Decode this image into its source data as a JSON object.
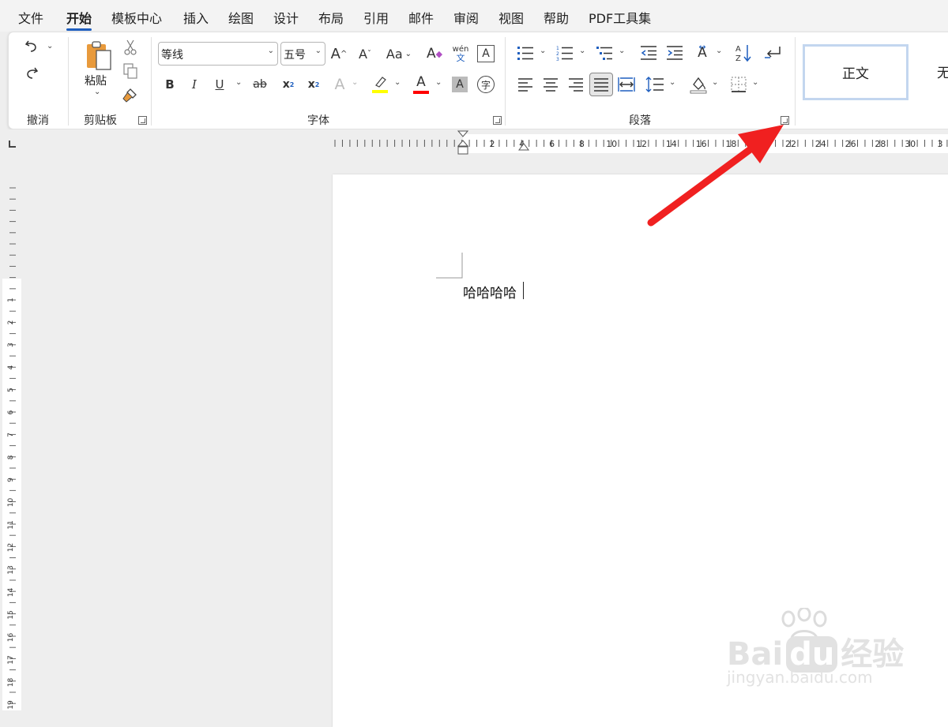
{
  "menu": {
    "tabs": [
      "文件",
      "开始",
      "模板中心",
      "插入",
      "绘图",
      "设计",
      "布局",
      "引用",
      "邮件",
      "审阅",
      "视图",
      "帮助",
      "PDF工具集"
    ],
    "active_tab": "开始"
  },
  "ribbon": {
    "undo_group_label": "撤消",
    "clipboard": {
      "paste_label": "粘贴",
      "group_label": "剪贴板"
    },
    "font": {
      "name_value": "等线",
      "size_value": "五号",
      "group_label": "字体",
      "phonetic_top": "wén",
      "phonetic_bottom": "文"
    },
    "paragraph": {
      "group_label": "段落"
    },
    "styles": {
      "normal_label": "正文",
      "next_label": "无"
    }
  },
  "document": {
    "text": "哈哈哈哈"
  },
  "ruler": {
    "h_labels": [
      "2",
      "4",
      "6",
      "8",
      "10",
      "12",
      "14",
      "16",
      "18",
      "20",
      "22",
      "24",
      "26",
      "28",
      "30",
      "3"
    ],
    "v_labels": [
      "1",
      "2",
      "3",
      "4",
      "5",
      "6",
      "7",
      "8",
      "9",
      "10",
      "11",
      "12",
      "13",
      "14",
      "15",
      "16",
      "17",
      "18",
      "19"
    ]
  },
  "watermark": {
    "brand": "Bai",
    "brand_tail": "du",
    "cn": "经验",
    "url": "jingyan.baidu.com"
  },
  "colors": {
    "accent": "#1f5fbf",
    "highlight": "#ffff00",
    "font_color": "#ff0000",
    "arrow": "#f02020"
  }
}
